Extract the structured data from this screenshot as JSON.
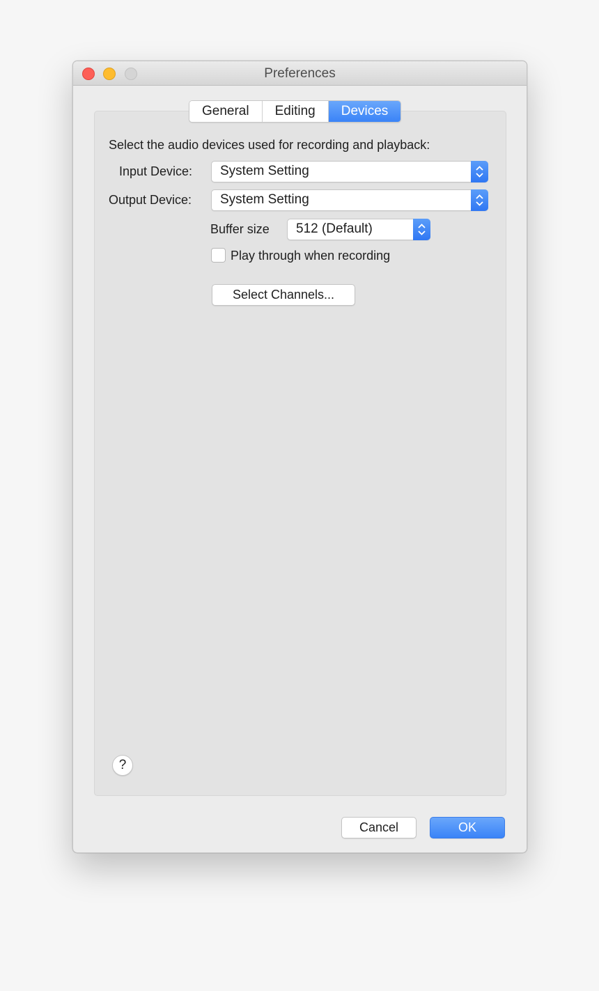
{
  "window": {
    "title": "Preferences",
    "traffic_lights": {
      "close": "#fd5f57",
      "minimize": "#febc2e",
      "zoom": "#d5d5d5"
    }
  },
  "tabs": [
    {
      "label": "General",
      "active": false
    },
    {
      "label": "Editing",
      "active": false
    },
    {
      "label": "Devices",
      "active": true
    }
  ],
  "devices": {
    "description": "Select the audio devices used for recording and playback:",
    "input_label": "Input Device:",
    "input_value": "System Setting",
    "output_label": "Output Device:",
    "output_value": "System Setting",
    "buffer_label": "Buffer size",
    "buffer_value": "512 (Default)",
    "playthrough_label": "Play through when recording",
    "playthrough_checked": false,
    "select_channels_label": "Select Channels..."
  },
  "help_label": "?",
  "footer": {
    "cancel_label": "Cancel",
    "ok_label": "OK"
  },
  "colors": {
    "accent": "#3a83f7",
    "window_bg": "#ececec",
    "panel_bg": "#e3e3e3"
  },
  "icons": {
    "stepper": "chevron-up-down-icon",
    "help": "question-mark-icon"
  }
}
